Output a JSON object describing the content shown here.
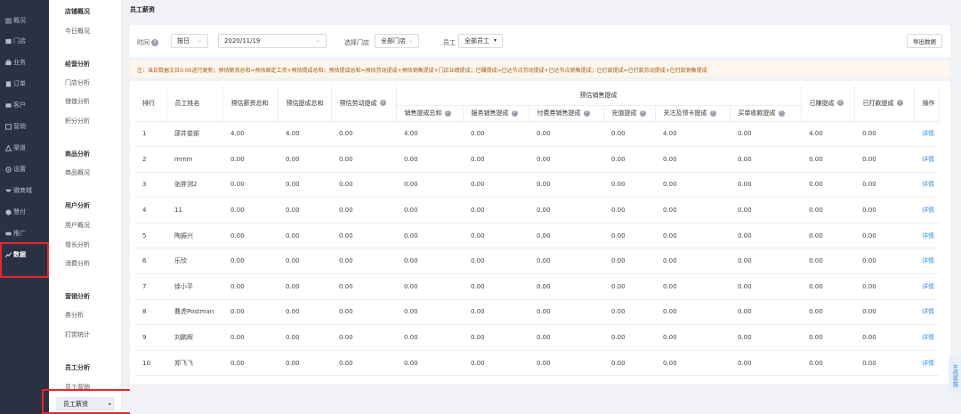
{
  "nav": {
    "items": [
      {
        "label": "概况",
        "icon": "bars-icon"
      },
      {
        "label": "门店",
        "icon": "store-icon"
      },
      {
        "label": "业务",
        "icon": "briefcase-icon"
      },
      {
        "label": "订单",
        "icon": "order-icon"
      },
      {
        "label": "客户",
        "icon": "customer-icon"
      },
      {
        "label": "营销",
        "icon": "marketing-icon"
      },
      {
        "label": "渠道",
        "icon": "channel-icon"
      },
      {
        "label": "设置",
        "icon": "gear-icon"
      },
      {
        "label": "微商城",
        "icon": "shop-icon"
      },
      {
        "label": "慧付",
        "icon": "pay-icon"
      },
      {
        "label": "推广",
        "icon": "promote-icon"
      },
      {
        "label": "数据",
        "icon": "data-icon"
      }
    ]
  },
  "sub": {
    "sections": [
      {
        "title": "店铺概况",
        "items": [
          "今日概况"
        ]
      },
      {
        "title": "经营分析",
        "items": [
          "门店分析",
          "储值分析",
          "积分分析"
        ]
      },
      {
        "title": "商品分析",
        "items": [
          "商品概况"
        ]
      },
      {
        "title": "用户分析",
        "items": [
          "用户概况",
          "增长分析",
          "消费分析"
        ]
      },
      {
        "title": "营销分析",
        "items": [
          "券分析",
          "打赏统计"
        ]
      },
      {
        "title": "员工分析",
        "items": [
          "员工营销",
          "员工薪资"
        ]
      }
    ],
    "active_arrow": "▸"
  },
  "page": {
    "title": "员工薪资",
    "filter": {
      "time_label": "时间",
      "period_value": "按日",
      "date_value": "2020/11/19",
      "store_label": "选择门店",
      "store_value": "全部门店",
      "staff_label": "员工",
      "staff_value": "全部员工",
      "export_label": "导出数据"
    },
    "notice": "注：当日数据次日0:00进行更新；预估薪资总和=预估固定工资+预估提成总和；预估提成总和=预估劳动提成+预估销售提成+门店业绩提成；已赚提成=已达节点劳动提成+已达节点销售提成；已打款提成=已打款劳动提成+已打款销售提成",
    "float_service": "在线客服"
  },
  "table": {
    "headers": {
      "rank": "排行",
      "name": "员工姓名",
      "total_salary": "预估薪资总和",
      "total_commission": "预估提成总和",
      "labor_commission": "预估劳动提成",
      "sales_group": "预估销售提成",
      "sales_total": "销售提成总和",
      "service_sales": "服务销售提成",
      "voucher_sales": "付费券销售提成",
      "recharge": "充值提成",
      "follow_card": "关注及领卡提成",
      "single_buy": "买单收款提成",
      "earned": "已赚提成",
      "paid": "已打款提成",
      "ops": "操作"
    },
    "rows": [
      {
        "rank": "1",
        "name": "邵井俊部",
        "total_salary": "4.00",
        "total_commission": "4.00",
        "labor": "0.00",
        "sales_total": "4.00",
        "service": "0.00",
        "voucher": "0.00",
        "recharge": "0.00",
        "follow": "4.00",
        "single": "0.00",
        "earned": "4.00",
        "paid": "0.00",
        "op": "详情"
      },
      {
        "rank": "2",
        "name": "mmm",
        "total_salary": "0.00",
        "total_commission": "0.00",
        "labor": "0.00",
        "sales_total": "0.00",
        "service": "0.00",
        "voucher": "0.00",
        "recharge": "0.00",
        "follow": "0.00",
        "single": "0.00",
        "earned": "0.00",
        "paid": "0.00",
        "op": "详情"
      },
      {
        "rank": "3",
        "name": "张胖测2",
        "total_salary": "0.00",
        "total_commission": "0.00",
        "labor": "0.00",
        "sales_total": "0.00",
        "service": "0.00",
        "voucher": "0.00",
        "recharge": "0.00",
        "follow": "0.00",
        "single": "0.00",
        "earned": "0.00",
        "paid": "0.00",
        "op": "详情"
      },
      {
        "rank": "4",
        "name": "11",
        "total_salary": "0.00",
        "total_commission": "0.00",
        "labor": "0.00",
        "sales_total": "0.00",
        "service": "0.00",
        "voucher": "0.00",
        "recharge": "0.00",
        "follow": "0.00",
        "single": "0.00",
        "earned": "0.00",
        "paid": "0.00",
        "op": "详情"
      },
      {
        "rank": "5",
        "name": "陶振兴",
        "total_salary": "0.00",
        "total_commission": "0.00",
        "labor": "0.00",
        "sales_total": "0.00",
        "service": "0.00",
        "voucher": "0.00",
        "recharge": "0.00",
        "follow": "0.00",
        "single": "0.00",
        "earned": "0.00",
        "paid": "0.00",
        "op": "详情"
      },
      {
        "rank": "6",
        "name": "乐欣",
        "total_salary": "0.00",
        "total_commission": "0.00",
        "labor": "0.00",
        "sales_total": "0.00",
        "service": "0.00",
        "voucher": "0.00",
        "recharge": "0.00",
        "follow": "0.00",
        "single": "0.00",
        "earned": "0.00",
        "paid": "0.00",
        "op": "详情"
      },
      {
        "rank": "7",
        "name": "徐小平",
        "total_salary": "0.00",
        "total_commission": "0.00",
        "labor": "0.00",
        "sales_total": "0.00",
        "service": "0.00",
        "voucher": "0.00",
        "recharge": "0.00",
        "follow": "0.00",
        "single": "0.00",
        "earned": "0.00",
        "paid": "0.00",
        "op": "详情"
      },
      {
        "rank": "8",
        "name": "曹虎Postman",
        "total_salary": "0.00",
        "total_commission": "0.00",
        "labor": "0.00",
        "sales_total": "0.00",
        "service": "0.00",
        "voucher": "0.00",
        "recharge": "0.00",
        "follow": "0.00",
        "single": "0.00",
        "earned": "0.00",
        "paid": "0.00",
        "op": "详情"
      },
      {
        "rank": "9",
        "name": "刘鹏辉",
        "total_salary": "0.00",
        "total_commission": "0.00",
        "labor": "0.00",
        "sales_total": "0.00",
        "service": "0.00",
        "voucher": "0.00",
        "recharge": "0.00",
        "follow": "0.00",
        "single": "0.00",
        "earned": "0.00",
        "paid": "0.00",
        "op": "详情"
      },
      {
        "rank": "10",
        "name": "郑飞飞",
        "total_salary": "0.00",
        "total_commission": "0.00",
        "labor": "0.00",
        "sales_total": "0.00",
        "service": "0.00",
        "voucher": "0.00",
        "recharge": "0.00",
        "follow": "0.00",
        "single": "0.00",
        "earned": "0.00",
        "paid": "0.00",
        "op": "详情"
      }
    ]
  },
  "colors": {
    "nav_bg": "#2b3143",
    "link": "#3a8ee6",
    "highlight_box": "#e6262b",
    "notice_bg": "#fdf6ec"
  }
}
